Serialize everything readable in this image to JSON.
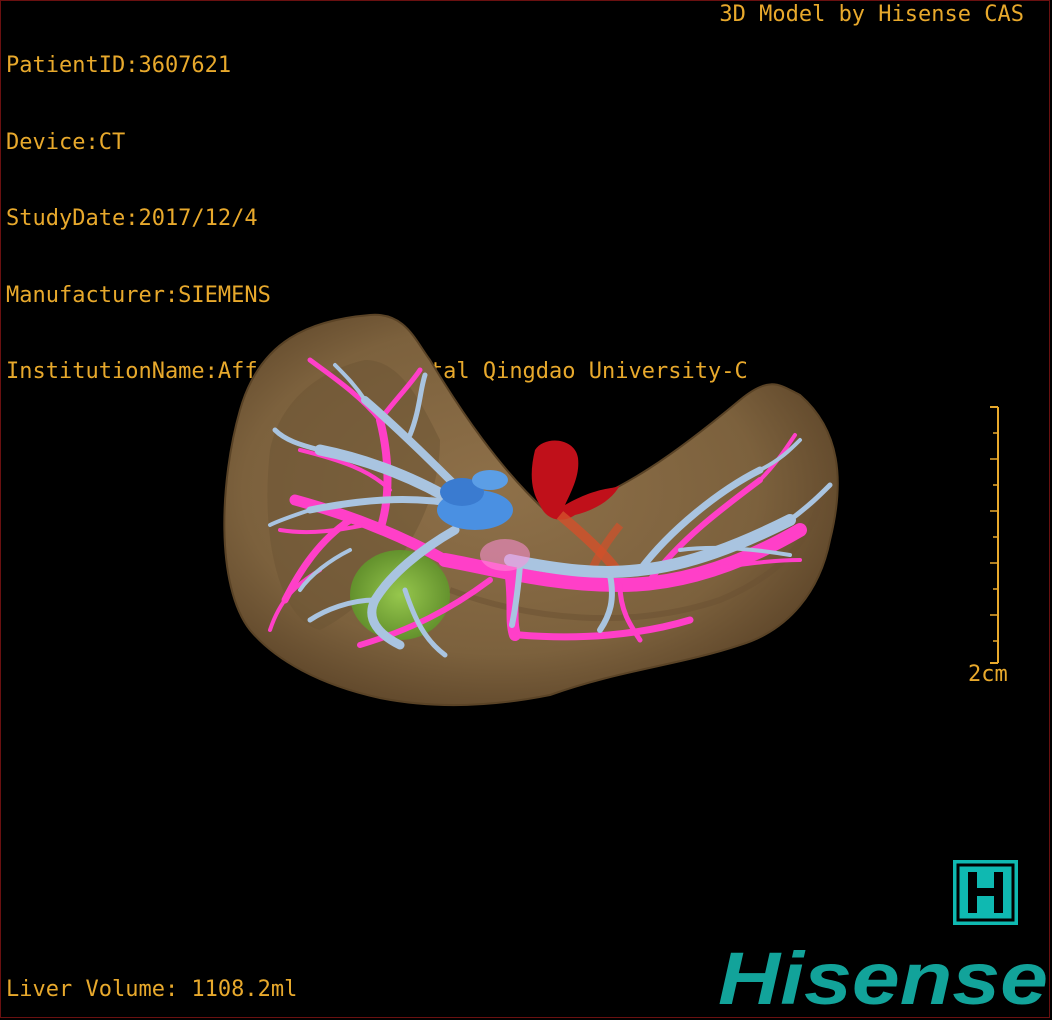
{
  "metadata": {
    "patient_id": "PatientID:3607621",
    "device": "Device:CT",
    "study_date": "StudyDate:2017/12/4",
    "manufacturer": "Manufacturer:SIEMENS",
    "institution": "InstitutionName:Affiliated Hospital Qingdao University-C"
  },
  "credit": "3D Model by Hisense CAS",
  "volume": "Liver Volume: 1108.2ml",
  "scale_bar": {
    "label": "2cm"
  },
  "brand": {
    "logo_text": "Hisense",
    "badge_letter": "H",
    "color": "#12a39a"
  },
  "colors": {
    "text": "#e8a92c",
    "liver": "#8a6d45",
    "hepatic_vein": "#a9c4e0",
    "portal_vein": "#ff3fc8",
    "vena_cava": "#4a90e2",
    "artery": "#c0101a",
    "gallbladder": "#7bc142"
  }
}
